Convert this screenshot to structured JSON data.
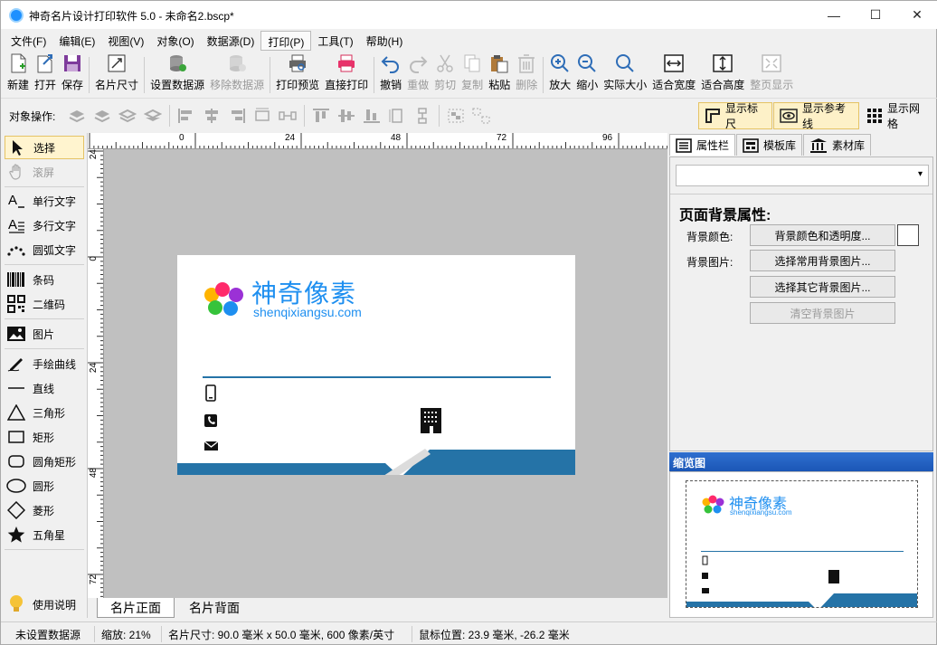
{
  "app": {
    "title": "神奇名片设计打印软件 5.0 - 未命名2.bscp*",
    "window_controls": {
      "minimize": "—",
      "maximize": "☐",
      "close": "✕"
    }
  },
  "menu": [
    "文件(F)",
    "编辑(E)",
    "视图(V)",
    "对象(O)",
    "数据源(D)",
    "打印(P)",
    "工具(T)",
    "帮助(H)"
  ],
  "menu_active_index": 5,
  "toolbar": [
    {
      "label": "新建",
      "icon": "new-file-icon",
      "enabled": true
    },
    {
      "label": "打开",
      "icon": "open-icon",
      "enabled": true
    },
    {
      "label": "保存",
      "icon": "save-icon",
      "enabled": true
    },
    {
      "label": "名片尺寸",
      "icon": "card-size-icon",
      "enabled": true
    },
    {
      "label": "设置数据源",
      "icon": "database-icon",
      "enabled": true
    },
    {
      "label": "移除数据源",
      "icon": "database-remove-icon",
      "enabled": false
    },
    {
      "label": "打印预览",
      "icon": "print-preview-icon",
      "enabled": true
    },
    {
      "label": "直接打印",
      "icon": "printer-icon",
      "enabled": true
    },
    {
      "label": "撤销",
      "icon": "undo-icon",
      "enabled": true
    },
    {
      "label": "重做",
      "icon": "redo-icon",
      "enabled": false
    },
    {
      "label": "剪切",
      "icon": "cut-icon",
      "enabled": false
    },
    {
      "label": "复制",
      "icon": "copy-icon",
      "enabled": false
    },
    {
      "label": "粘贴",
      "icon": "paste-icon",
      "enabled": true
    },
    {
      "label": "删除",
      "icon": "delete-icon",
      "enabled": false
    },
    {
      "label": "放大",
      "icon": "zoom-in-icon",
      "enabled": true
    },
    {
      "label": "缩小",
      "icon": "zoom-out-icon",
      "enabled": true
    },
    {
      "label": "实际大小",
      "icon": "actual-size-icon",
      "enabled": true
    },
    {
      "label": "适合宽度",
      "icon": "fit-width-icon",
      "enabled": true
    },
    {
      "label": "适合高度",
      "icon": "fit-height-icon",
      "enabled": true
    },
    {
      "label": "整页显示",
      "icon": "fit-page-icon",
      "enabled": false
    }
  ],
  "ops": {
    "label": "对象操作:",
    "toggles": [
      {
        "label": "显示标尺",
        "icon": "ruler-icon",
        "on": true
      },
      {
        "label": "显示参考线",
        "icon": "eye-icon",
        "on": true
      },
      {
        "label": "显示网格",
        "icon": "grid-icon",
        "on": false
      }
    ]
  },
  "tools": [
    {
      "label": "选择",
      "icon": "select-arrow-icon",
      "selected": true,
      "enabled": true
    },
    {
      "label": "滚屏",
      "icon": "hand-icon",
      "selected": false,
      "enabled": false
    },
    {
      "label": "单行文字",
      "icon": "single-line-text-icon",
      "selected": false,
      "enabled": true
    },
    {
      "label": "多行文字",
      "icon": "multi-line-text-icon",
      "selected": false,
      "enabled": true
    },
    {
      "label": "圆弧文字",
      "icon": "arc-text-icon",
      "selected": false,
      "enabled": true
    },
    {
      "label": "条码",
      "icon": "barcode-icon",
      "selected": false,
      "enabled": true
    },
    {
      "label": "二维码",
      "icon": "qrcode-icon",
      "selected": false,
      "enabled": true
    },
    {
      "label": "图片",
      "icon": "image-icon",
      "selected": false,
      "enabled": true
    },
    {
      "label": "手绘曲线",
      "icon": "pen-icon",
      "selected": false,
      "enabled": true
    },
    {
      "label": "直线",
      "icon": "line-icon",
      "selected": false,
      "enabled": true
    },
    {
      "label": "三角形",
      "icon": "triangle-icon",
      "selected": false,
      "enabled": true
    },
    {
      "label": "矩形",
      "icon": "rectangle-icon",
      "selected": false,
      "enabled": true
    },
    {
      "label": "圆角矩形",
      "icon": "rounded-rect-icon",
      "selected": false,
      "enabled": true
    },
    {
      "label": "圆形",
      "icon": "ellipse-icon",
      "selected": false,
      "enabled": true
    },
    {
      "label": "菱形",
      "icon": "diamond-icon",
      "selected": false,
      "enabled": true
    },
    {
      "label": "五角星",
      "icon": "star-icon",
      "selected": false,
      "enabled": true
    }
  ],
  "help": {
    "label": "使用说明",
    "icon": "lightbulb-icon"
  },
  "ruler": {
    "h_labels": [
      "0",
      "24",
      "48",
      "72",
      "96"
    ],
    "v_labels": [
      "24",
      "0",
      "24",
      "48",
      "72"
    ]
  },
  "card": {
    "brand_name": "神奇像素",
    "brand_url": "shenqixiangsu.com",
    "accent_color": "#2573a7",
    "contact_icons": [
      "mobile-phone-icon",
      "telephone-icon",
      "envelope-icon"
    ],
    "building_icon": "building-icon"
  },
  "bottom_tabs": [
    {
      "label": "名片正面",
      "active": true
    },
    {
      "label": "名片背面",
      "active": false
    }
  ],
  "right_panel": {
    "tabs": [
      {
        "label": "属性栏",
        "icon": "list-icon",
        "active": true
      },
      {
        "label": "模板库",
        "icon": "template-icon",
        "active": false
      },
      {
        "label": "素材库",
        "icon": "library-icon",
        "active": false
      }
    ],
    "combo_value": "",
    "section_title": "页面背景属性:",
    "bg_color_label": "背景颜色:",
    "bg_color_button": "背景颜色和透明度...",
    "bg_color_value": "#ffffff",
    "bg_image_label": "背景图片:",
    "bg_image_common_button": "选择常用背景图片...",
    "bg_image_other_button": "选择其它背景图片...",
    "bg_image_clear_button": "清空背景图片"
  },
  "preview": {
    "title": "缩览图"
  },
  "status": {
    "datasource": "未设置数据源",
    "zoom": "缩放: 21%",
    "card_size": "名片尺寸: 90.0 毫米 x 50.0 毫米, 600 像素/英寸",
    "mouse_pos": "鼠标位置: 23.9 毫米, -26.2 毫米"
  }
}
